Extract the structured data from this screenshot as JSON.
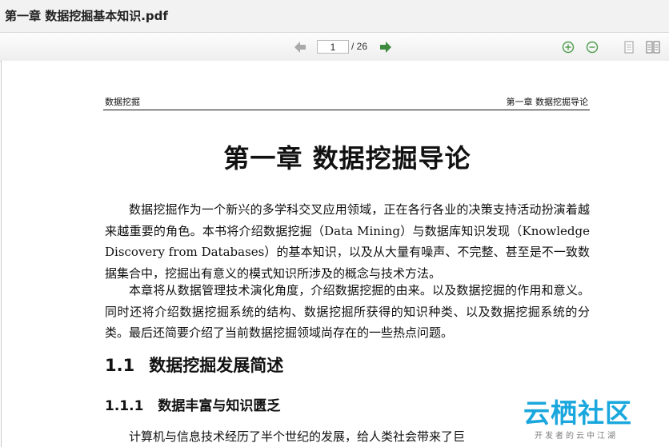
{
  "window": {
    "title": "第一章 数据挖掘基本知识.pdf"
  },
  "toolbar": {
    "current_page": "1",
    "total_pages": "/ 26",
    "icons": [
      "arrow-left-icon",
      "arrow-right-icon",
      "zoom-in-icon",
      "zoom-out-icon",
      "single-page-icon",
      "two-page-icon"
    ],
    "colors": {
      "nav_arrow": "#3f8a3f",
      "nav_arrow_disabled": "#a9a9a9",
      "zoom": "#4f9d4f"
    }
  },
  "document": {
    "running_header_left": "数据挖掘",
    "running_header_right": "第一章  数据挖掘导论",
    "chapter_title": "第一章    数据挖掘导论",
    "paragraphs": [
      "数据挖掘作为一个新兴的多学科交叉应用领域，正在各行各业的决策支持活动扮演着越来越重要的角色。本书将介绍数据挖掘（Data Mining）与数据库知识发现（Knowledge Discovery from Databases）的基本知识，以及从大量有噪声、不完整、甚至是不一致数据集合中，挖掘出有意义的模式知识所涉及的概念与技术方法。",
      "本章将从数据管理技术演化角度，介绍数据挖掘的由来。以及数据挖掘的作用和意义。同时还将介绍数据挖掘系统的结构、数据挖掘所获得的知识种类、以及数据挖掘系统的分类。最后还简要介绍了当前数据挖掘领域尚存在的一些热点问题。"
    ],
    "section": {
      "number": "1.1",
      "title": "数据挖掘发展简述"
    },
    "subsection": {
      "number": "1.1.1",
      "title": "数据丰富与知识匮乏"
    },
    "partial_paragraph": "计算机与信息技术经历了半个世纪的发展，给人类社会带来了巨"
  },
  "watermark": {
    "logo": "云栖社区",
    "tagline": "开发者的云中江湖"
  }
}
